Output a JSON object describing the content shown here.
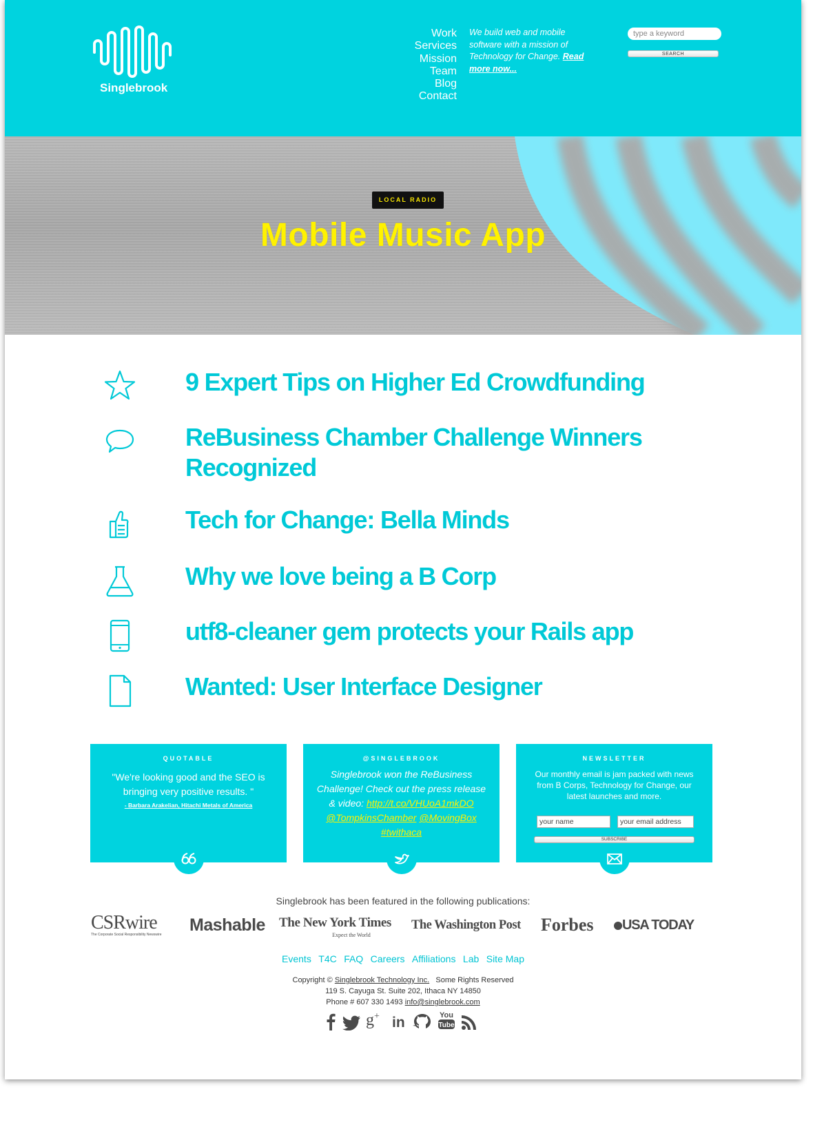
{
  "header": {
    "logo_text": "Singlebrook",
    "nav": [
      "Work",
      "Services",
      "Mission",
      "Team",
      "Blog",
      "Contact"
    ],
    "tagline": "We build web and mobile software with a mission of Technology for Change.",
    "tagline_link": "Read more now...",
    "search_placeholder": "type a keyword",
    "search_button": "SEARCH"
  },
  "hero": {
    "badge": "LOCAL RADIO",
    "title": "Mobile Music App"
  },
  "articles": [
    {
      "icon": "star-icon",
      "title": "9 Expert Tips on Higher Ed Crowdfunding"
    },
    {
      "icon": "speech-bubble-icon",
      "title": "ReBusiness Chamber Challenge Winners Recognized"
    },
    {
      "icon": "thumbs-up-icon",
      "title": "Tech for Change: Bella Minds"
    },
    {
      "icon": "flask-icon",
      "title": "Why we love being a B Corp"
    },
    {
      "icon": "mobile-phone-icon",
      "title": "utf8-cleaner gem protects your Rails app"
    },
    {
      "icon": "document-icon",
      "title": "Wanted: User Interface Designer"
    }
  ],
  "boxes": {
    "quotable": {
      "title": "QUOTABLE",
      "quote": "\"We're looking good and the SEO is bringing very positive results. \"",
      "cite": "- Barbara Arakelian, Hitachi Metals of America",
      "icon": "quote-icon"
    },
    "twitter": {
      "title": "@SINGLEBROOK",
      "text": "Singlebrook won the ReBusiness Challenge! Check out the press release & video:",
      "link": "http://t.co/VHUoA1mkDO",
      "tag1": "@TompkinsChamber",
      "tag2": "@MovingBox",
      "tag3": "#twithaca",
      "icon": "twitter-bird-icon"
    },
    "newsletter": {
      "title": "NEWSLETTER",
      "text": "Our monthly email is jam packed with news from B Corps, Technology for Change, our latest launches and more.",
      "name_placeholder": "your name",
      "email_placeholder": "your email address",
      "button": "SUBSCRIBE",
      "icon": "envelope-icon"
    }
  },
  "featured": {
    "label": "Singlebrook has been featured in the following publications:",
    "publications": [
      "CSRwire",
      "Mashable",
      "The New York Times",
      "The Washington Post",
      "Forbes",
      "USA TODAY"
    ],
    "csr_tagline": "The Corporate Social Responsibility Newswire",
    "nyt_tagline": "Expect the World"
  },
  "footer": {
    "links": [
      "Events",
      "T4C",
      "FAQ",
      "Careers",
      "Affiliations",
      "Lab",
      "Site Map"
    ],
    "copyright_prefix": "Copyright ©",
    "company": "Singlebrook Technology Inc.",
    "rights": "Some Rights Reserved",
    "address": "119 S. Cayuga St. Suite 202, Ithaca NY 14850",
    "phone": "Phone # 607 330 1493",
    "email": "info@singlebrook.com",
    "social": [
      "facebook-icon",
      "twitter-icon",
      "google-plus-icon",
      "linkedin-icon",
      "github-icon",
      "youtube-icon",
      "rss-icon"
    ]
  },
  "colors": {
    "brand": "#00d3df",
    "headline": "#00c9d7",
    "hero_title": "#fff200"
  }
}
